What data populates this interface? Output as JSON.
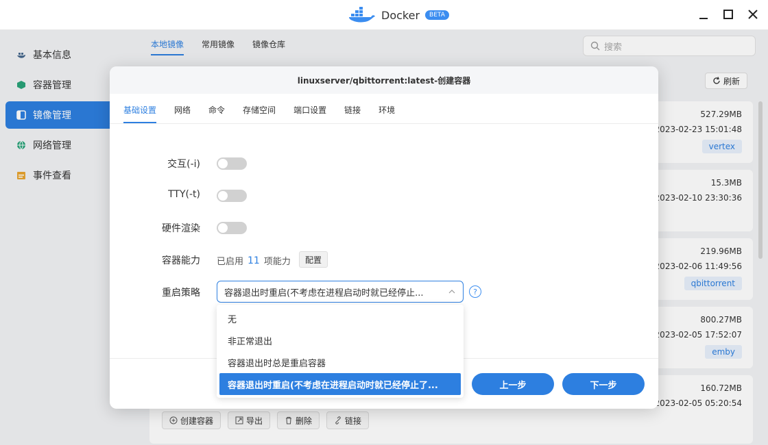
{
  "window": {
    "app_name": "Docker",
    "badge": "BETA"
  },
  "sidebar": {
    "items": [
      {
        "label": "基本信息",
        "icon": "info-icon"
      },
      {
        "label": "容器管理",
        "icon": "cube-icon"
      },
      {
        "label": "镜像管理",
        "icon": "image-icon",
        "active": true
      },
      {
        "label": "网络管理",
        "icon": "globe-icon"
      },
      {
        "label": "事件查看",
        "icon": "calendar-icon"
      }
    ]
  },
  "main": {
    "tabs": [
      "本地镜像",
      "常用镜像",
      "镜像仓库"
    ],
    "search_placeholder": "搜索",
    "refresh_label": "刷新",
    "images": [
      {
        "size": "527.29MB",
        "date": "2023-02-23 15:01:48",
        "tag": "vertex"
      },
      {
        "size": "15.3MB",
        "date": "2023-02-10 23:30:36",
        "tag": ""
      },
      {
        "size": "219.96MB",
        "date": "2023-02-06 11:49:56",
        "tag": "qbittorrent"
      },
      {
        "size": "800.27MB",
        "date": "2023-02-05 17:52:07",
        "tag": "emby"
      },
      {
        "size": "160.72MB",
        "date": "2023-02-05 05:20:54",
        "tag": ""
      }
    ],
    "actions": [
      "创建容器",
      "导出",
      "删除",
      "链接"
    ]
  },
  "modal": {
    "title": "linuxserver/qbittorrent:latest-创建容器",
    "tabs": [
      "基础设置",
      "网络",
      "命令",
      "存储空间",
      "端口设置",
      "链接",
      "环境"
    ],
    "fields": {
      "interactive_label": "交互(-i)",
      "tty_label": "TTY(-t)",
      "hw_label": "硬件渲染",
      "capability_label": "容器能力",
      "capability_prefix": "已启用",
      "capability_count": "11",
      "capability_suffix": "项能力",
      "config_button": "配置",
      "restart_label": "重启策略",
      "restart_value": "容器退出时重启(不考虑在进程启动时就已经停止...",
      "help_glyph": "?"
    },
    "restart_options": [
      "无",
      "非正常退出",
      "容器退出时总是重启容器",
      "容器退出时重启(不考虑在进程启动时就已经停止了..."
    ],
    "prev_button": "上一步",
    "next_button": "下一步"
  },
  "colors": {
    "accent": "#2d7fe0",
    "tag_bg": "#e8f1fc"
  }
}
